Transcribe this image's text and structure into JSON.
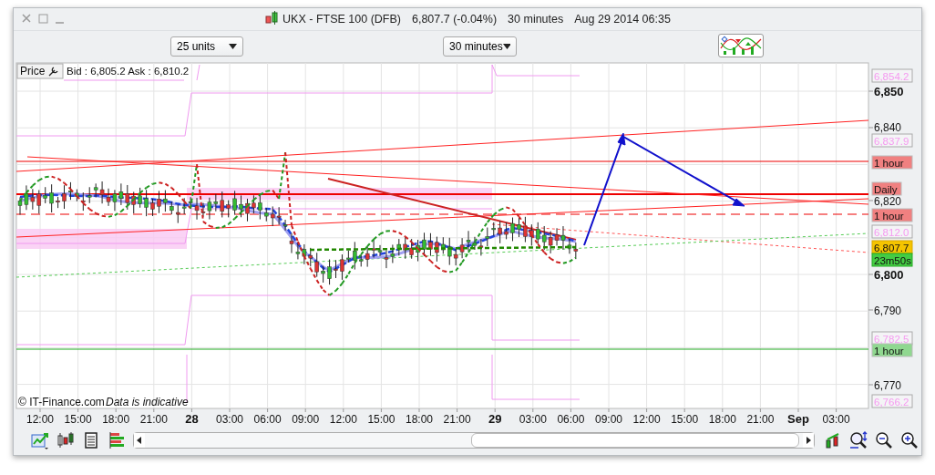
{
  "window": {
    "title": {
      "symbol": "UKX - FTSE 100 (DFB)",
      "quote": "6,807.7 (-0.04%)",
      "interval": "30 minutes",
      "datetime": "Aug 29 2014 06:35"
    }
  },
  "toolbar": {
    "units": "25 units",
    "interval": "30 minutes"
  },
  "chart": {
    "legend": {
      "label": "Price",
      "quote": "Bid : 6,805.2 Ask : 6,810.2"
    },
    "y_axis": [
      {
        "label": "6,850",
        "kind": "major"
      },
      {
        "label": "6,840",
        "kind": "minor"
      },
      {
        "label": "6,820",
        "kind": "minor"
      },
      {
        "label": "6,800",
        "kind": "major"
      },
      {
        "label": "6,790",
        "kind": "minor"
      },
      {
        "label": "6,770",
        "kind": "minor"
      }
    ],
    "x_axis": [
      {
        "label": "12:00",
        "kind": "time"
      },
      {
        "label": "15:00",
        "kind": "time"
      },
      {
        "label": "18:00",
        "kind": "time"
      },
      {
        "label": "21:00",
        "kind": "time"
      },
      {
        "label": "28",
        "kind": "day"
      },
      {
        "label": "03:00",
        "kind": "time"
      },
      {
        "label": "06:00",
        "kind": "time"
      },
      {
        "label": "09:00",
        "kind": "time"
      },
      {
        "label": "12:00",
        "kind": "time"
      },
      {
        "label": "15:00",
        "kind": "time"
      },
      {
        "label": "18:00",
        "kind": "time"
      },
      {
        "label": "21:00",
        "kind": "time"
      },
      {
        "label": "29",
        "kind": "day"
      },
      {
        "label": "03:00",
        "kind": "time"
      },
      {
        "label": "06:00",
        "kind": "time"
      },
      {
        "label": "09:00",
        "kind": "time"
      },
      {
        "label": "12:00",
        "kind": "time"
      },
      {
        "label": "15:00",
        "kind": "time"
      },
      {
        "label": "18:00",
        "kind": "time"
      },
      {
        "label": "21:00",
        "kind": "time"
      },
      {
        "label": "Sep",
        "kind": "day"
      },
      {
        "label": "03:00",
        "kind": "time"
      }
    ],
    "tags": [
      {
        "label": "6,854.2",
        "kind": "level"
      },
      {
        "label": "6,837.9",
        "kind": "level"
      },
      {
        "label": "1 hour",
        "kind": "alert",
        "color": "#f08080"
      },
      {
        "label": "Daily",
        "kind": "alert",
        "color": "#f08080"
      },
      {
        "label": "1 hour",
        "kind": "alert",
        "color": "#f08080"
      },
      {
        "label": "6,812.0",
        "kind": "level"
      },
      {
        "label": "6,807.7",
        "kind": "price"
      },
      {
        "label": "23m50s",
        "kind": "timer"
      },
      {
        "label": "6,782.5",
        "kind": "level"
      },
      {
        "label": "1 hour",
        "kind": "alert",
        "color": "#90d890"
      },
      {
        "label": "6,766.2",
        "kind": "level"
      }
    ],
    "footer": {
      "copyright": "© IT-Finance.com",
      "note": "Data is indicative"
    }
  }
}
